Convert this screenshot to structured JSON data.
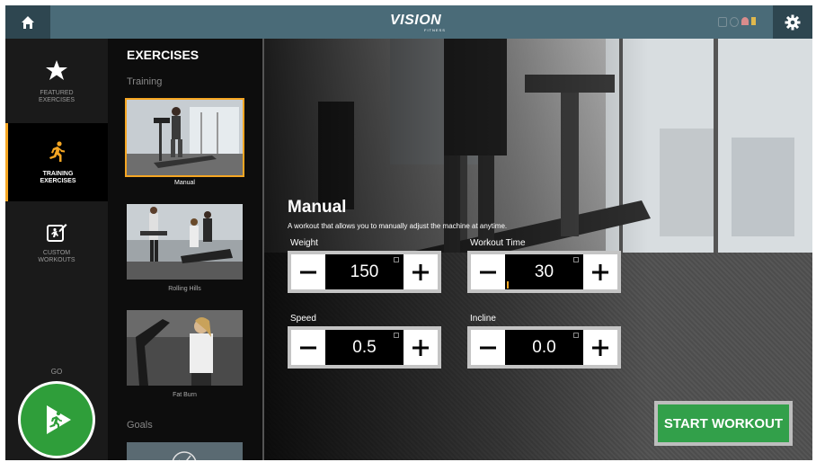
{
  "topbar": {
    "logo_main": "VISION",
    "logo_sub": "FITNESS"
  },
  "nav": {
    "items": [
      {
        "label_line1": "FEATURED",
        "label_line2": "EXERCISES",
        "icon": "star-icon"
      },
      {
        "label_line1": "TRAINING",
        "label_line2": "EXERCISES",
        "icon": "runner-icon",
        "active": true
      },
      {
        "label_line1": "CUSTOM",
        "label_line2": "WORKOUTS",
        "icon": "custom-workout-icon"
      }
    ],
    "go_label": "GO"
  },
  "exercises": {
    "title": "EXERCISES",
    "section": "Training",
    "items": [
      {
        "label": "Manual",
        "selected": true
      },
      {
        "label": "Rolling Hills"
      },
      {
        "label": "Fat Burn"
      }
    ],
    "goals_label": "Goals"
  },
  "workout": {
    "title": "Manual",
    "description": "A workout that allows you to manually adjust the machine at anytime.",
    "params": {
      "weight": {
        "label": "Weight",
        "value": "150"
      },
      "time": {
        "label": "Workout Time",
        "value": "30"
      },
      "speed": {
        "label": "Speed",
        "value": "0.5"
      },
      "incline": {
        "label": "Incline",
        "value": "0.0"
      }
    },
    "start_label": "START WORKOUT"
  },
  "colors": {
    "accent": "#f5a623",
    "go_green": "#2f9e3a",
    "start_green": "#32a04a",
    "topbar": "#4a6b78"
  }
}
